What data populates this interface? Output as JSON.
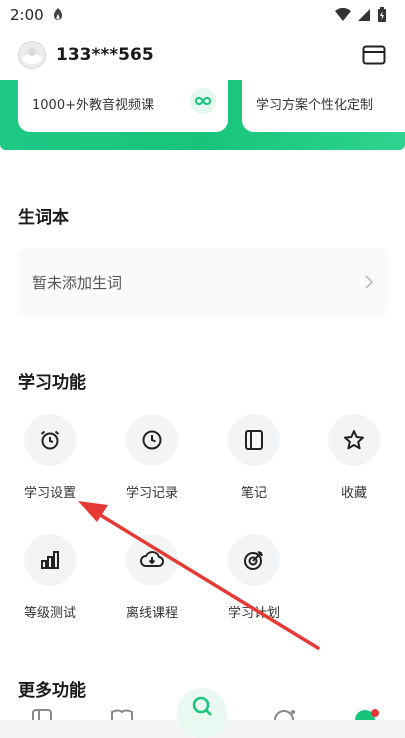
{
  "statusbar": {
    "time": "2:00"
  },
  "header": {
    "username": "133***565"
  },
  "promos": [
    {
      "subtitle": "1000+外教音视频课"
    },
    {
      "subtitle": "学习方案个性化定制"
    }
  ],
  "vocab": {
    "title": "生词本",
    "empty_text": "暂未添加生词"
  },
  "features": {
    "title": "学习功能",
    "items": [
      {
        "label": "学习设置",
        "icon": "alarm-clock-icon"
      },
      {
        "label": "学习记录",
        "icon": "clock-icon"
      },
      {
        "label": "笔记",
        "icon": "notebook-icon"
      },
      {
        "label": "收藏",
        "icon": "star-icon"
      },
      {
        "label": "等级测试",
        "icon": "bar-chart-icon"
      },
      {
        "label": "离线课程",
        "icon": "cloud-download-icon"
      },
      {
        "label": "学习计划",
        "icon": "target-icon"
      }
    ]
  },
  "more": {
    "title": "更多功能"
  },
  "colors": {
    "accent": "#17c57a",
    "annotation_arrow": "#e53935"
  }
}
